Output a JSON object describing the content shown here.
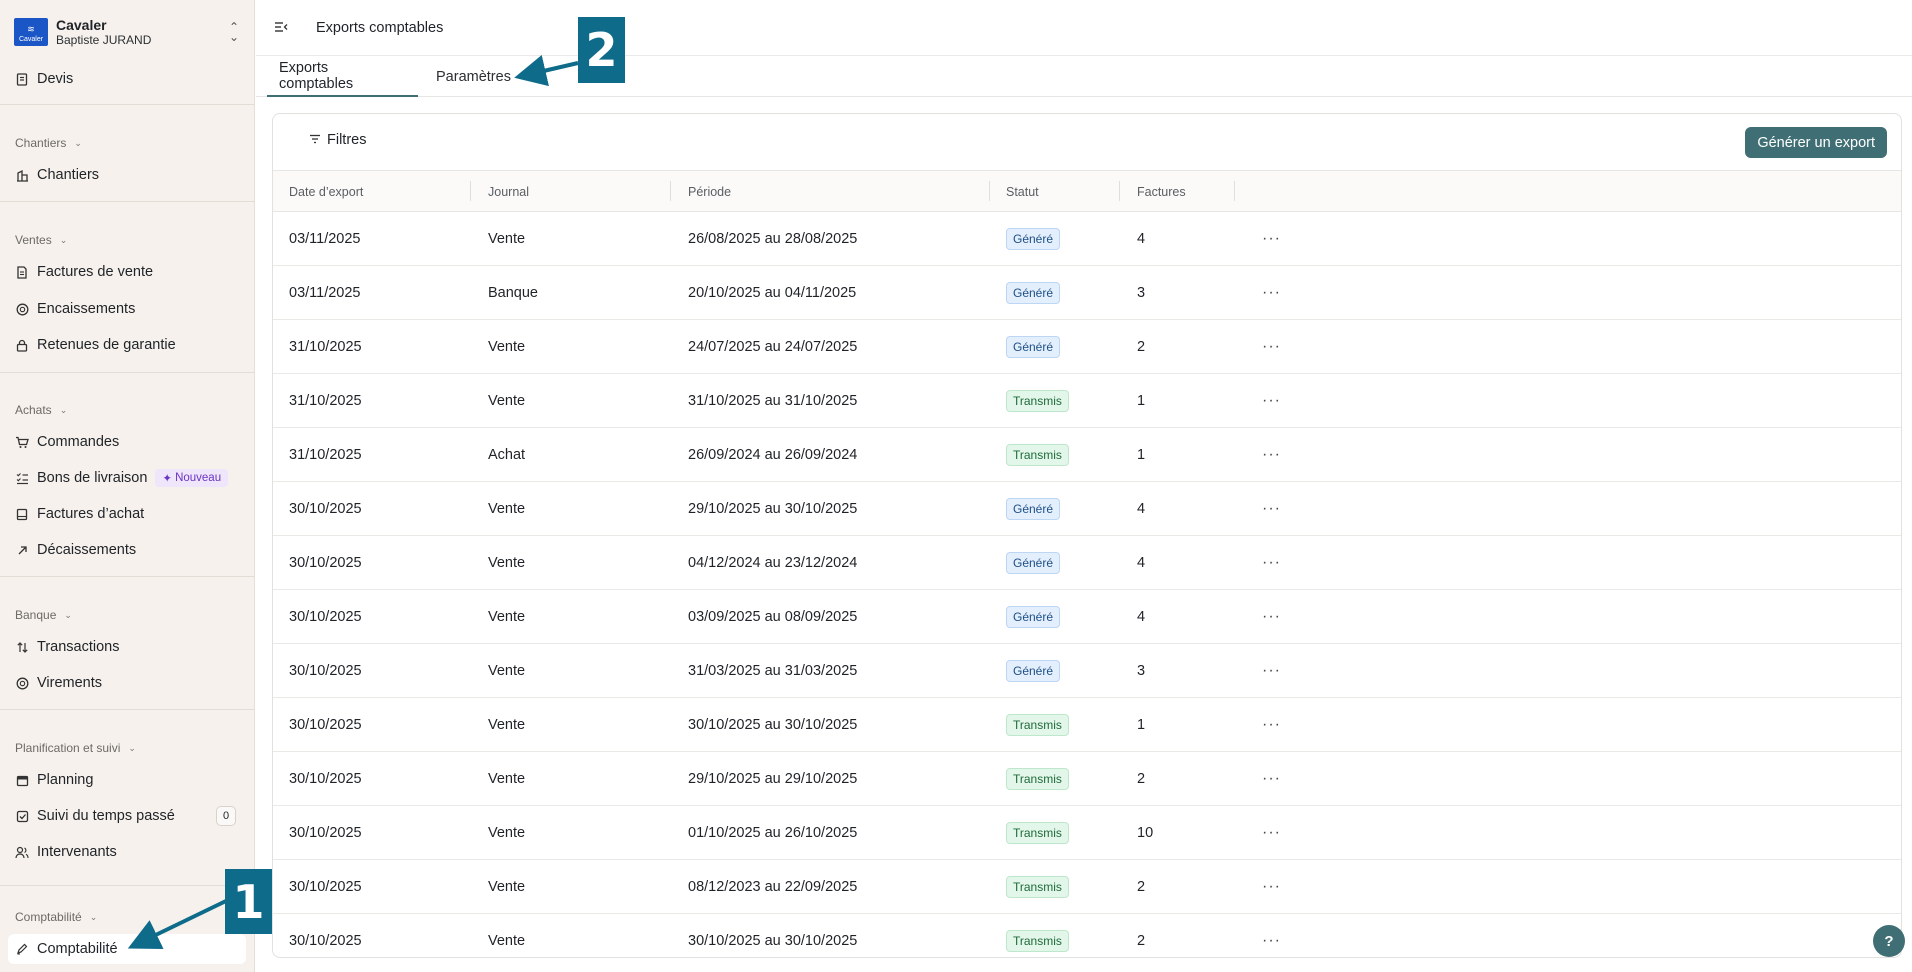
{
  "org": {
    "name": "Cavaler",
    "user": "Baptiste JURAND",
    "logo_text": "Cavaler"
  },
  "sidebar": {
    "top_items": [
      {
        "label": "Devis",
        "icon": "document-icon"
      }
    ],
    "sections": [
      {
        "title": "Chantiers",
        "items": [
          {
            "label": "Chantiers",
            "icon": "building-icon"
          }
        ]
      },
      {
        "title": "Ventes",
        "items": [
          {
            "label": "Factures de vente",
            "icon": "invoice-icon"
          },
          {
            "label": "Encaissements",
            "icon": "coin-icon"
          },
          {
            "label": "Retenues de garantie",
            "icon": "lock-icon"
          }
        ]
      },
      {
        "title": "Achats",
        "items": [
          {
            "label": "Commandes",
            "icon": "cart-icon"
          },
          {
            "label": "Bons de livraison",
            "icon": "checklist-icon",
            "badge": "Nouveau"
          },
          {
            "label": "Factures d’achat",
            "icon": "receipt-icon"
          },
          {
            "label": "Décaissements",
            "icon": "arrow-up-right-icon"
          }
        ]
      },
      {
        "title": "Banque",
        "items": [
          {
            "label": "Transactions",
            "icon": "transfer-icon"
          },
          {
            "label": "Virements",
            "icon": "coin-icon"
          }
        ]
      },
      {
        "title": "Planification et suivi",
        "items": [
          {
            "label": "Planning",
            "icon": "calendar-icon"
          },
          {
            "label": "Suivi du temps passé",
            "icon": "checkbox-icon",
            "count": "0"
          },
          {
            "label": "Intervenants",
            "icon": "users-icon"
          }
        ]
      },
      {
        "title": "Comptabilité",
        "items": [
          {
            "label": "Comptabilité",
            "icon": "pen-icon",
            "active": true
          }
        ]
      }
    ]
  },
  "header": {
    "title": "Exports comptables"
  },
  "tabs": [
    {
      "label": "Exports comptables",
      "active": true
    },
    {
      "label": "Paramètres",
      "active": false
    }
  ],
  "toolbar": {
    "filters_label": "Filtres",
    "generate_label": "Générer un export"
  },
  "table": {
    "columns": [
      "Date d’export",
      "Journal",
      "Période",
      "Statut",
      "Factures"
    ],
    "rows": [
      {
        "date": "03/11/2025",
        "journal": "Vente",
        "period": "26/08/2025 au 28/08/2025",
        "status": "Généré",
        "invoices": "4"
      },
      {
        "date": "03/11/2025",
        "journal": "Banque",
        "period": "20/10/2025 au 04/11/2025",
        "status": "Généré",
        "invoices": "3"
      },
      {
        "date": "31/10/2025",
        "journal": "Vente",
        "period": "24/07/2025 au 24/07/2025",
        "status": "Généré",
        "invoices": "2"
      },
      {
        "date": "31/10/2025",
        "journal": "Vente",
        "period": "31/10/2025 au 31/10/2025",
        "status": "Transmis",
        "invoices": "1"
      },
      {
        "date": "31/10/2025",
        "journal": "Achat",
        "period": "26/09/2024 au 26/09/2024",
        "status": "Transmis",
        "invoices": "1"
      },
      {
        "date": "30/10/2025",
        "journal": "Vente",
        "period": "29/10/2025 au 30/10/2025",
        "status": "Généré",
        "invoices": "4"
      },
      {
        "date": "30/10/2025",
        "journal": "Vente",
        "period": "04/12/2024 au 23/12/2024",
        "status": "Généré",
        "invoices": "4"
      },
      {
        "date": "30/10/2025",
        "journal": "Vente",
        "period": "03/09/2025 au 08/09/2025",
        "status": "Généré",
        "invoices": "4"
      },
      {
        "date": "30/10/2025",
        "journal": "Vente",
        "period": "31/03/2025 au 31/03/2025",
        "status": "Généré",
        "invoices": "3"
      },
      {
        "date": "30/10/2025",
        "journal": "Vente",
        "period": "30/10/2025 au 30/10/2025",
        "status": "Transmis",
        "invoices": "1"
      },
      {
        "date": "30/10/2025",
        "journal": "Vente",
        "period": "29/10/2025 au 29/10/2025",
        "status": "Transmis",
        "invoices": "2"
      },
      {
        "date": "30/10/2025",
        "journal": "Vente",
        "period": "01/10/2025 au 26/10/2025",
        "status": "Transmis",
        "invoices": "10"
      },
      {
        "date": "30/10/2025",
        "journal": "Vente",
        "period": "08/12/2023 au 22/09/2025",
        "status": "Transmis",
        "invoices": "2"
      },
      {
        "date": "30/10/2025",
        "journal": "Vente",
        "period": "30/10/2025 au 30/10/2025",
        "status": "Transmis",
        "invoices": "2"
      }
    ],
    "row_action": "···"
  },
  "annotations": [
    {
      "label": "1"
    },
    {
      "label": "2"
    }
  ],
  "help": {
    "label": "?"
  },
  "colors": {
    "accent": "#3f6f74",
    "callout": "#0e6b8a",
    "sidebar_bg": "#f6f1ec"
  }
}
